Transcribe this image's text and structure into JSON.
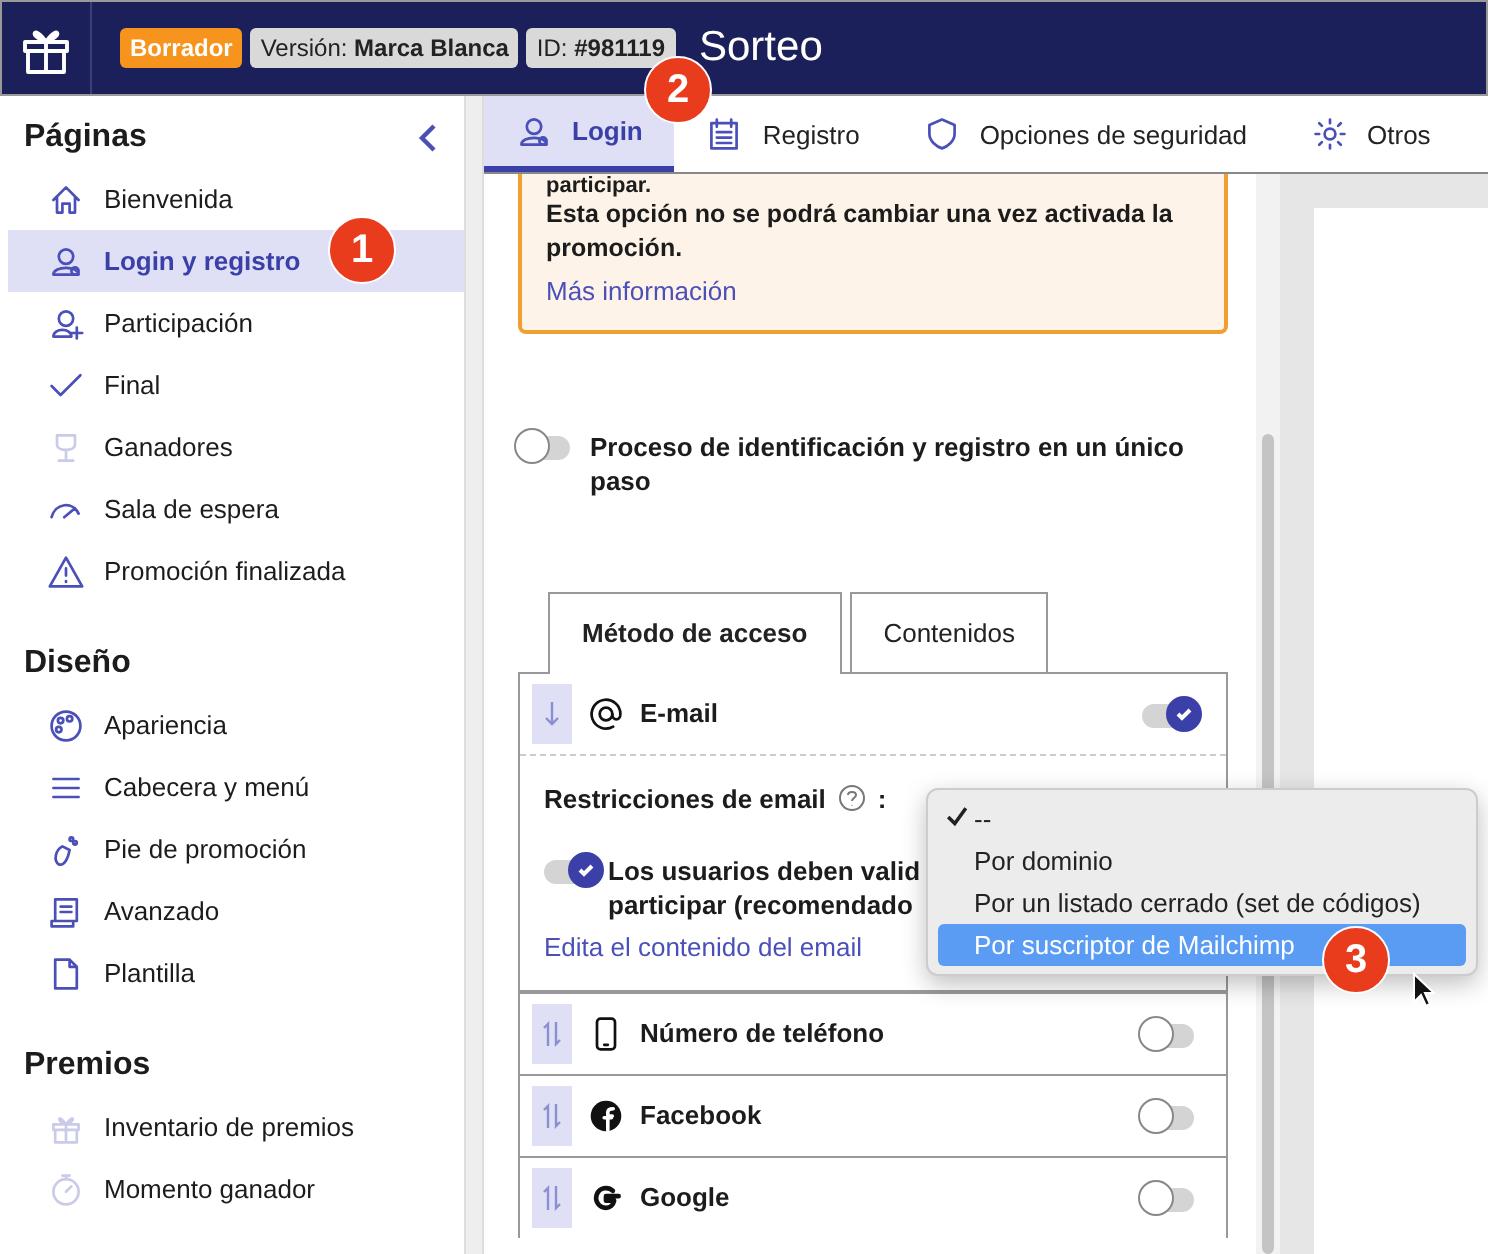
{
  "header": {
    "status_badge": "Borrador",
    "version_badge": "Versión: **Marca Blanca**",
    "id_badge": "ID: **#981119**",
    "title": "Sorteo"
  },
  "sidebar": {
    "sections": [
      {
        "title": "Páginas",
        "items": [
          {
            "label": "Bienvenida",
            "selected": false
          },
          {
            "label": "Login y registro",
            "selected": true
          },
          {
            "label": "Participación",
            "selected": false
          },
          {
            "label": "Final",
            "selected": false
          },
          {
            "label": "Ganadores",
            "selected": false
          },
          {
            "label": "Sala de espera",
            "selected": false
          },
          {
            "label": "Promoción finalizada",
            "selected": false
          }
        ]
      },
      {
        "title": "Diseño",
        "items": [
          {
            "label": "Apariencia",
            "selected": false
          },
          {
            "label": "Cabecera y menú",
            "selected": false
          },
          {
            "label": "Pie de promoción",
            "selected": false
          },
          {
            "label": "Avanzado",
            "selected": false
          },
          {
            "label": "Plantilla",
            "selected": false
          }
        ]
      },
      {
        "title": "Premios",
        "items": [
          {
            "label": "Inventario de premios",
            "selected": false
          },
          {
            "label": "Momento ganador",
            "selected": false
          }
        ]
      }
    ]
  },
  "tabs": [
    {
      "label": "Login",
      "selected": true
    },
    {
      "label": "Registro",
      "selected": false
    },
    {
      "label": "Opciones de seguridad",
      "selected": false
    },
    {
      "label": "Otros",
      "selected": false
    }
  ],
  "warning": {
    "lines": [
      "participar.",
      "Esta opción no se podrá cambiar una vez activada la promoción."
    ],
    "link": "Más información"
  },
  "single_step": {
    "label": "Proceso de identificación y registro en un único paso",
    "on": false
  },
  "inner_tabs": [
    {
      "label": "Método de acceso",
      "selected": true
    },
    {
      "label": "Contenidos",
      "selected": false
    }
  ],
  "methods": [
    {
      "label": "E-mail",
      "on": true,
      "expanded": true,
      "restriction_label": "Restricciones de email",
      "restriction_colon": ":",
      "validate_on": true,
      "validate_lines": [
        "Los usuarios deben valid",
        "participar (recomendado"
      ],
      "edit_link": "Edita el contenido del email"
    },
    {
      "label": "Número de teléfono",
      "on": false,
      "expanded": false
    },
    {
      "label": "Facebook",
      "on": false,
      "expanded": false
    },
    {
      "label": "Google",
      "on": false,
      "expanded": false
    }
  ],
  "dropdown": {
    "items": [
      {
        "label": "--",
        "selected": true,
        "hovered": false
      },
      {
        "label": "Por dominio",
        "selected": false,
        "hovered": false
      },
      {
        "label": "Por un listado cerrado (set de códigos)",
        "selected": false,
        "hovered": false
      },
      {
        "label": "Por suscriptor de Mailchimp",
        "selected": false,
        "hovered": true
      }
    ]
  },
  "callouts": [
    "1",
    "2",
    "3"
  ]
}
